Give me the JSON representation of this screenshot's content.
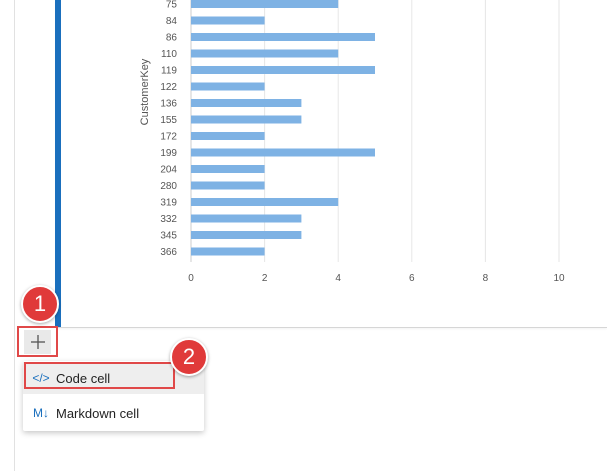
{
  "chart_data": {
    "type": "bar",
    "orientation": "horizontal",
    "ylabel": "CustomerKey",
    "categories": [
      "75",
      "84",
      "86",
      "110",
      "119",
      "122",
      "136",
      "155",
      "172",
      "199",
      "204",
      "280",
      "319",
      "332",
      "345",
      "366"
    ],
    "values": [
      4,
      2,
      5,
      4,
      5,
      2,
      3,
      3,
      2,
      5,
      2,
      2,
      4,
      3,
      3,
      2
    ],
    "xticks": [
      "0",
      "2",
      "4",
      "6",
      "8",
      "10"
    ],
    "xlim": [
      0,
      10.8
    ],
    "grid": true,
    "bar_color": "#7eb2e4"
  },
  "add_cell": {
    "icon": "plus-icon"
  },
  "callouts": {
    "badge_1": "1",
    "badge_2": "2"
  },
  "menu": {
    "items": [
      {
        "label": "Code cell",
        "icon": "code-icon",
        "icon_text": "</>"
      },
      {
        "label": "Markdown cell",
        "icon": "markdown-icon",
        "icon_text": "M↓"
      }
    ]
  },
  "colors": {
    "accent": "#1a6fbd",
    "callout_red": "#e03a3a"
  }
}
